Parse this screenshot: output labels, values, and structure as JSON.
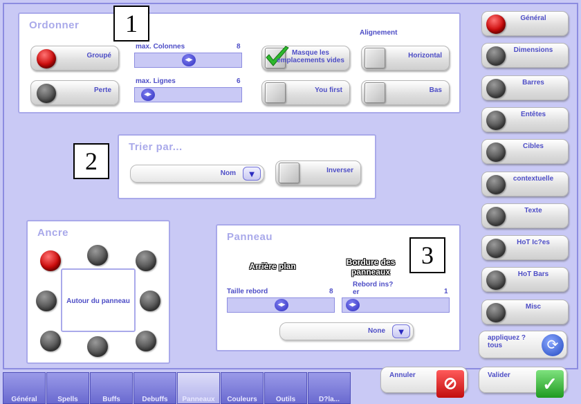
{
  "ordonner": {
    "title": "Ordonner",
    "alignement_label": "Alignement",
    "groupe": "Groupé",
    "perte": "Perte",
    "max_colonnes": "max. Colonnes",
    "max_colonnes_value": "8",
    "max_lignes": "max. Lignes",
    "max_lignes_value": "6",
    "masque": "Masque les emplacements vides",
    "you_first": "You first",
    "horizontal": "Horizontal",
    "bas": "Bas",
    "slider_colonnes_level": 0.5,
    "slider_lignes_level": 0.05
  },
  "trier": {
    "title": "Trier par...",
    "sort_value": "Nom",
    "inverser": "Inverser"
  },
  "ancre": {
    "title": "Ancre",
    "center_label": "Autour du panneau"
  },
  "panneau": {
    "title": "Panneau",
    "arriere_plan": "Arrière plan",
    "bordure": "Bordure des panneaux",
    "taille_rebord": "Taille rebord",
    "taille_rebord_value": "8",
    "rebord_inser": "Rebord ins?er",
    "rebord_inser_value": "1",
    "border_style": "None",
    "slider_taille_level": 0.5,
    "slider_rebord_level": 0.02
  },
  "sidebar": {
    "items": [
      {
        "label": "Général",
        "active": true
      },
      {
        "label": "Dimensions",
        "active": false
      },
      {
        "label": "Barres",
        "active": false
      },
      {
        "label": "Entêtes",
        "active": false
      },
      {
        "label": "Cibles",
        "active": false
      },
      {
        "label": "contextuelle",
        "active": false
      },
      {
        "label": "Texte",
        "active": false
      },
      {
        "label": "HoT Ic?es",
        "active": false
      },
      {
        "label": "HoT Bars",
        "active": false
      },
      {
        "label": "Misc",
        "active": false
      }
    ],
    "apply_all": "appliquez ?tous"
  },
  "actions": {
    "annuler": "Annuler",
    "valider": "Valider"
  },
  "tabs": [
    "Général",
    "Spells",
    "Buffs",
    "Debuffs",
    "Panneaux",
    "Couleurs",
    "Outils",
    "D?la..."
  ],
  "markers": {
    "m1": "1",
    "m2": "2",
    "m3": "3"
  },
  "colors": {
    "accent": "#4d4dc6",
    "background": "#c9c9f5",
    "led_on": "#cc0b0b",
    "check": "#2db82d"
  }
}
